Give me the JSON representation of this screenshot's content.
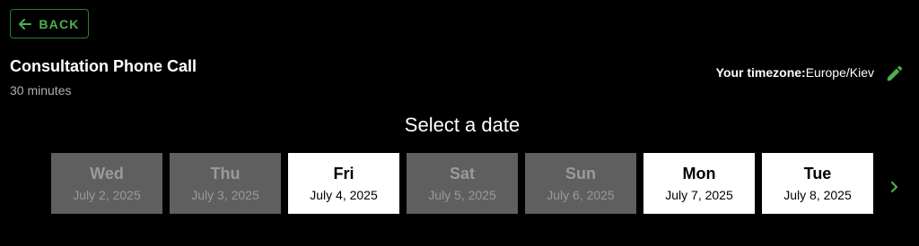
{
  "header": {
    "back_label": "BACK",
    "back_icon": "arrow-left-icon",
    "title": "Consultation Phone Call",
    "duration": "30 minutes"
  },
  "timezone": {
    "label": "Your timezone:",
    "value": "Europe/Kiev",
    "edit_icon": "pencil-icon"
  },
  "picker": {
    "heading": "Select a date",
    "next_icon": "chevron-right-icon",
    "dates": [
      {
        "day": "Wed",
        "date": "July 2, 2025",
        "available": false
      },
      {
        "day": "Thu",
        "date": "July 3, 2025",
        "available": false
      },
      {
        "day": "Fri",
        "date": "July 4, 2025",
        "available": true
      },
      {
        "day": "Sat",
        "date": "July 5, 2025",
        "available": false
      },
      {
        "day": "Sun",
        "date": "July 6, 2025",
        "available": false
      },
      {
        "day": "Mon",
        "date": "July 7, 2025",
        "available": true
      },
      {
        "day": "Tue",
        "date": "July 8, 2025",
        "available": true
      }
    ]
  },
  "colors": {
    "background": "#000000",
    "accent": "#4caf50",
    "accent_border": "#2e7d32",
    "disabled_card": "#5f5f5f",
    "disabled_text": "#9a9a9a",
    "available_card": "#ffffff"
  }
}
